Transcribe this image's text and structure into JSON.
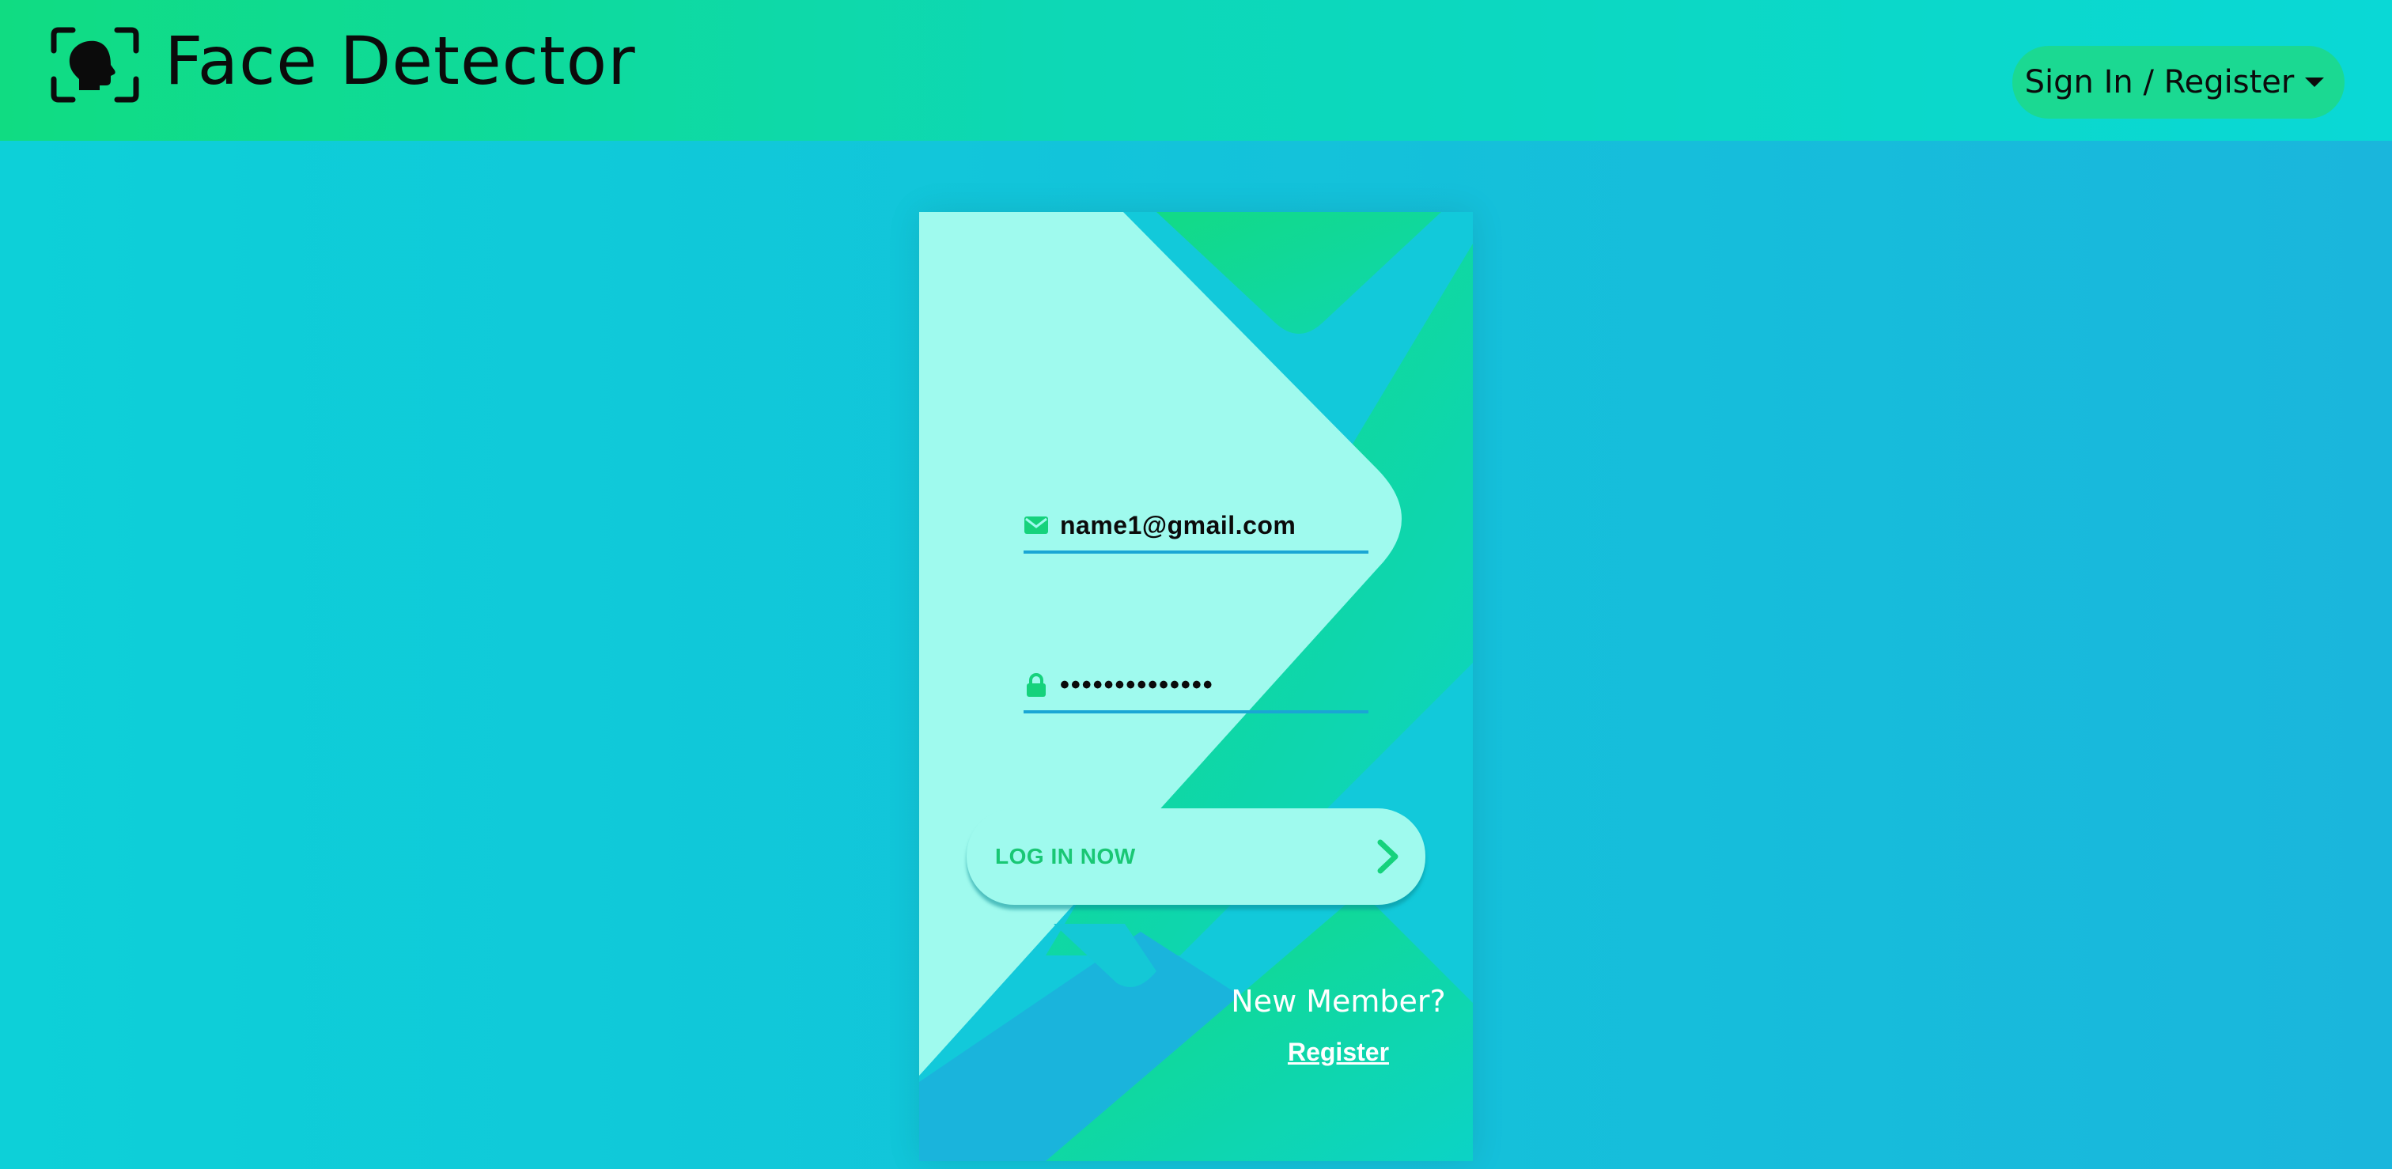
{
  "header": {
    "app_title": "Face Detector",
    "logo_icon": "face-scan-icon",
    "signin_label": "Sign In / Register",
    "signin_icon": "caret-down-icon"
  },
  "login_form": {
    "email": {
      "icon": "envelope-icon",
      "value": "name1@gmail.com"
    },
    "password": {
      "icon": "lock-icon",
      "value": "••••••••••••••"
    },
    "login_button": {
      "label": "LOG IN NOW",
      "icon": "chevron-right-icon"
    },
    "new_member_text": "New Member?",
    "register_link": "Register"
  },
  "colors": {
    "header_green": "#10dc82",
    "accent_green": "#1bd992",
    "mint": "#9ffaee",
    "page_cyan": "#13c3da",
    "underline_blue": "#1aa6d4"
  }
}
